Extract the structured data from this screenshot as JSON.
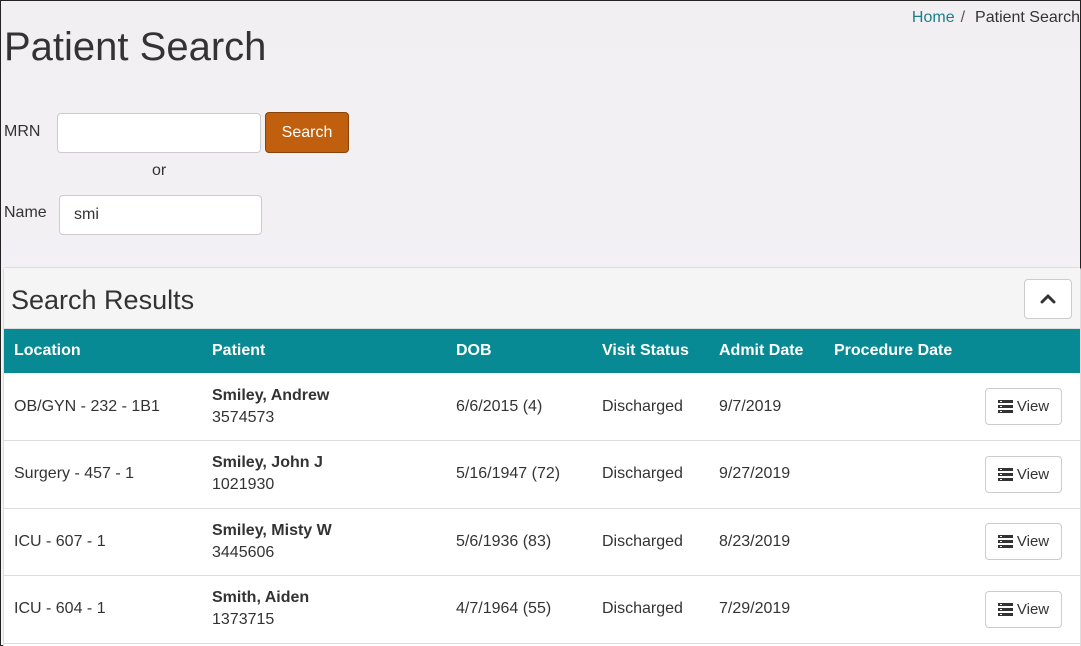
{
  "breadcrumb": {
    "home": "Home",
    "separator": "/",
    "current": "Patient Search"
  },
  "page_title": "Patient Search",
  "search_form": {
    "mrn_label": "MRN",
    "mrn_value": "",
    "search_button": "Search",
    "or_text": "or",
    "name_label": "Name",
    "name_value": "smi"
  },
  "results": {
    "title": "Search Results",
    "collapse_icon": "chevron-up-icon",
    "columns": [
      "Location",
      "Patient",
      "DOB",
      "Visit Status",
      "Admit Date",
      "Procedure Date"
    ],
    "view_label": "View",
    "view_icon": "list-icon",
    "rows": [
      {
        "location": "OB/GYN - 232 - 1B1",
        "name": "Smiley, Andrew",
        "mrn": "3574573",
        "dob": "6/6/2015 (4)",
        "status": "Discharged",
        "admit": "9/7/2019",
        "procedure": ""
      },
      {
        "location": "Surgery - 457 - 1",
        "name": "Smiley, John J",
        "mrn": "1021930",
        "dob": "5/16/1947 (72)",
        "status": "Discharged",
        "admit": "9/27/2019",
        "procedure": ""
      },
      {
        "location": "ICU - 607 - 1",
        "name": "Smiley, Misty W",
        "mrn": "3445606",
        "dob": "5/6/1936 (83)",
        "status": "Discharged",
        "admit": "8/23/2019",
        "procedure": ""
      },
      {
        "location": "ICU - 604 - 1",
        "name": "Smith, Aiden",
        "mrn": "1373715",
        "dob": "4/7/1964 (55)",
        "status": "Discharged",
        "admit": "7/29/2019",
        "procedure": ""
      }
    ]
  },
  "colors": {
    "header_teal": "#088a94",
    "search_orange": "#c0600e",
    "link": "#1b7f8a"
  }
}
